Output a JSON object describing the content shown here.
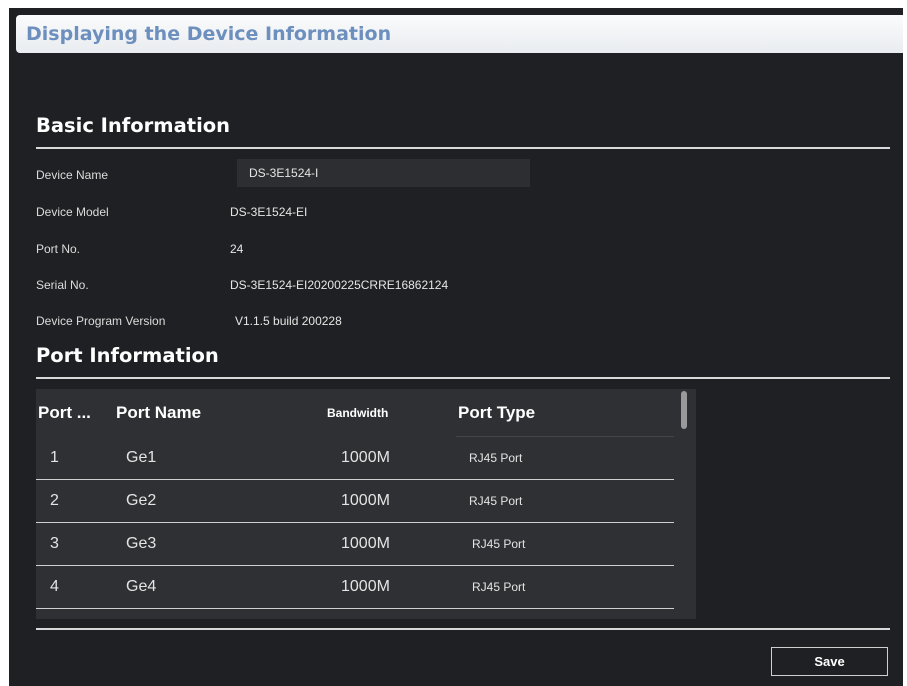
{
  "window": {
    "title": "Displaying the Device Information"
  },
  "basic": {
    "heading": "Basic Information",
    "device_name_label": "Device Name",
    "device_name_value": "DS-3E1524-I",
    "device_model_label": "Device Model",
    "device_model_value": "DS-3E1524-EI",
    "port_no_label": "Port No.",
    "port_no_value": "24",
    "serial_label": "Serial No.",
    "serial_value": "DS-3E1524-EI20200225CRRE16862124",
    "version_label": "Device Program Version",
    "version_value": "V1.1.5 build 200228"
  },
  "ports": {
    "heading": "Port Information",
    "columns": [
      "Port ...",
      "Port Name",
      "Bandwidth",
      "Port Type"
    ],
    "rows": [
      {
        "no": "1",
        "name": "Ge1",
        "bandwidth": "1000M",
        "type": "RJ45 Port"
      },
      {
        "no": "2",
        "name": "Ge2",
        "bandwidth": "1000M",
        "type": "RJ45 Port"
      },
      {
        "no": "3",
        "name": "Ge3",
        "bandwidth": "1000M",
        "type": "RJ45 Port"
      },
      {
        "no": "4",
        "name": "Ge4",
        "bandwidth": "1000M",
        "type": "RJ45 Port"
      }
    ]
  },
  "footer": {
    "save_label": "Save"
  }
}
